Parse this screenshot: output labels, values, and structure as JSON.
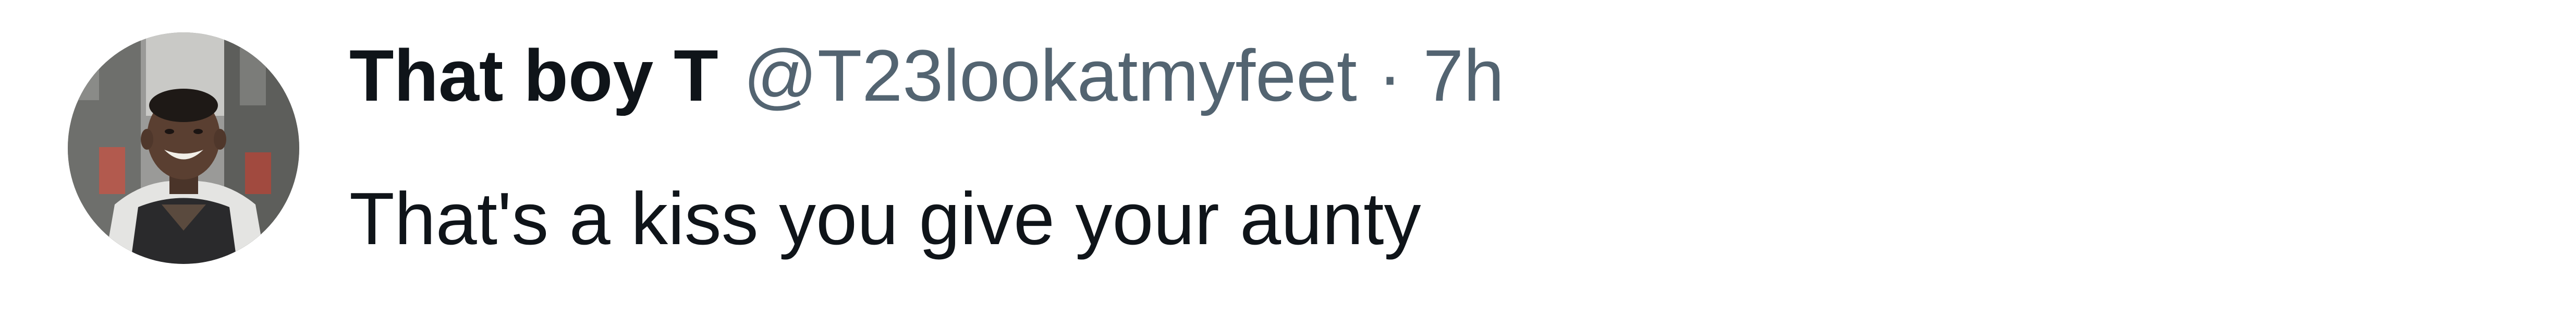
{
  "tweet": {
    "author": {
      "display_name": "That boy T",
      "handle": "@T23lookatmyfeet",
      "avatar": "avatar-photo"
    },
    "separator": "·",
    "timestamp": "7h",
    "text": "That's a kiss you give your aunty"
  },
  "colors": {
    "primary_text": "#0f1419",
    "secondary_text": "#536471",
    "background": "#ffffff"
  }
}
